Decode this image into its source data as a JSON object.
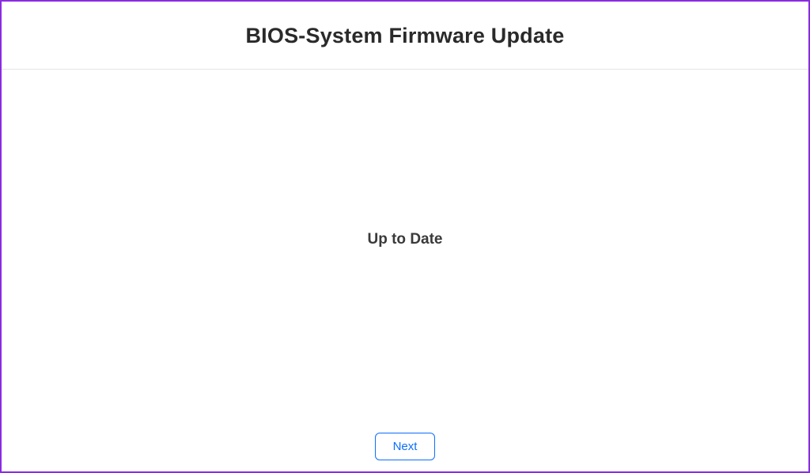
{
  "header": {
    "title": "BIOS-System Firmware Update"
  },
  "content": {
    "status": "Up to Date"
  },
  "footer": {
    "next_label": "Next"
  }
}
